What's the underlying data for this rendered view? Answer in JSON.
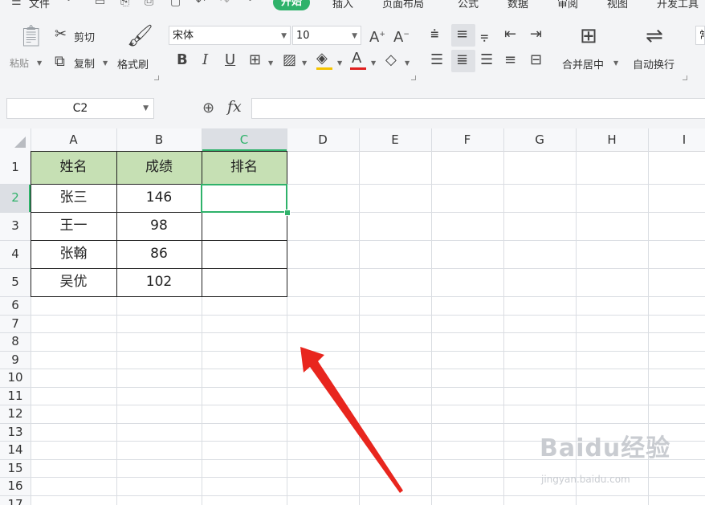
{
  "menubar": {
    "file_label": "文件",
    "tabs": [
      "开始",
      "插入",
      "页面布局",
      "公式",
      "数据",
      "审阅",
      "视图",
      "开发工具"
    ],
    "active_tab": "开始"
  },
  "ribbon": {
    "paste_label": "粘贴",
    "cut_label": "剪切",
    "copy_label": "复制",
    "format_painter_label": "格式刷",
    "font_name": "宋体",
    "font_size": "10",
    "bold": "B",
    "italic": "I",
    "underline": "U",
    "merge_center_label": "合并居中",
    "wrap_text_label": "自动换行",
    "partial_right_label": "常"
  },
  "formula_bar": {
    "name_box": "C2",
    "fx_label": "fx",
    "formula_value": ""
  },
  "sheet": {
    "columns": [
      "A",
      "B",
      "C",
      "D",
      "E",
      "F",
      "G",
      "H",
      "I"
    ],
    "rows": [
      "1",
      "2",
      "3",
      "4",
      "5",
      "6",
      "7",
      "8",
      "9",
      "10",
      "11",
      "12",
      "13",
      "14",
      "15",
      "16",
      "17"
    ],
    "selected_cell": "C2",
    "header_fill": "#c6e0b4",
    "accent": "#2fb26a",
    "table": {
      "headers": [
        "姓名",
        "成绩",
        "排名"
      ],
      "rows": [
        [
          "张三",
          "146",
          ""
        ],
        [
          "王一",
          "98",
          ""
        ],
        [
          "张翰",
          "86",
          ""
        ],
        [
          "吴优",
          "102",
          ""
        ]
      ]
    }
  },
  "watermark": {
    "logo_text": "Baidu经验",
    "url_text": "jingyan.baidu.com"
  }
}
